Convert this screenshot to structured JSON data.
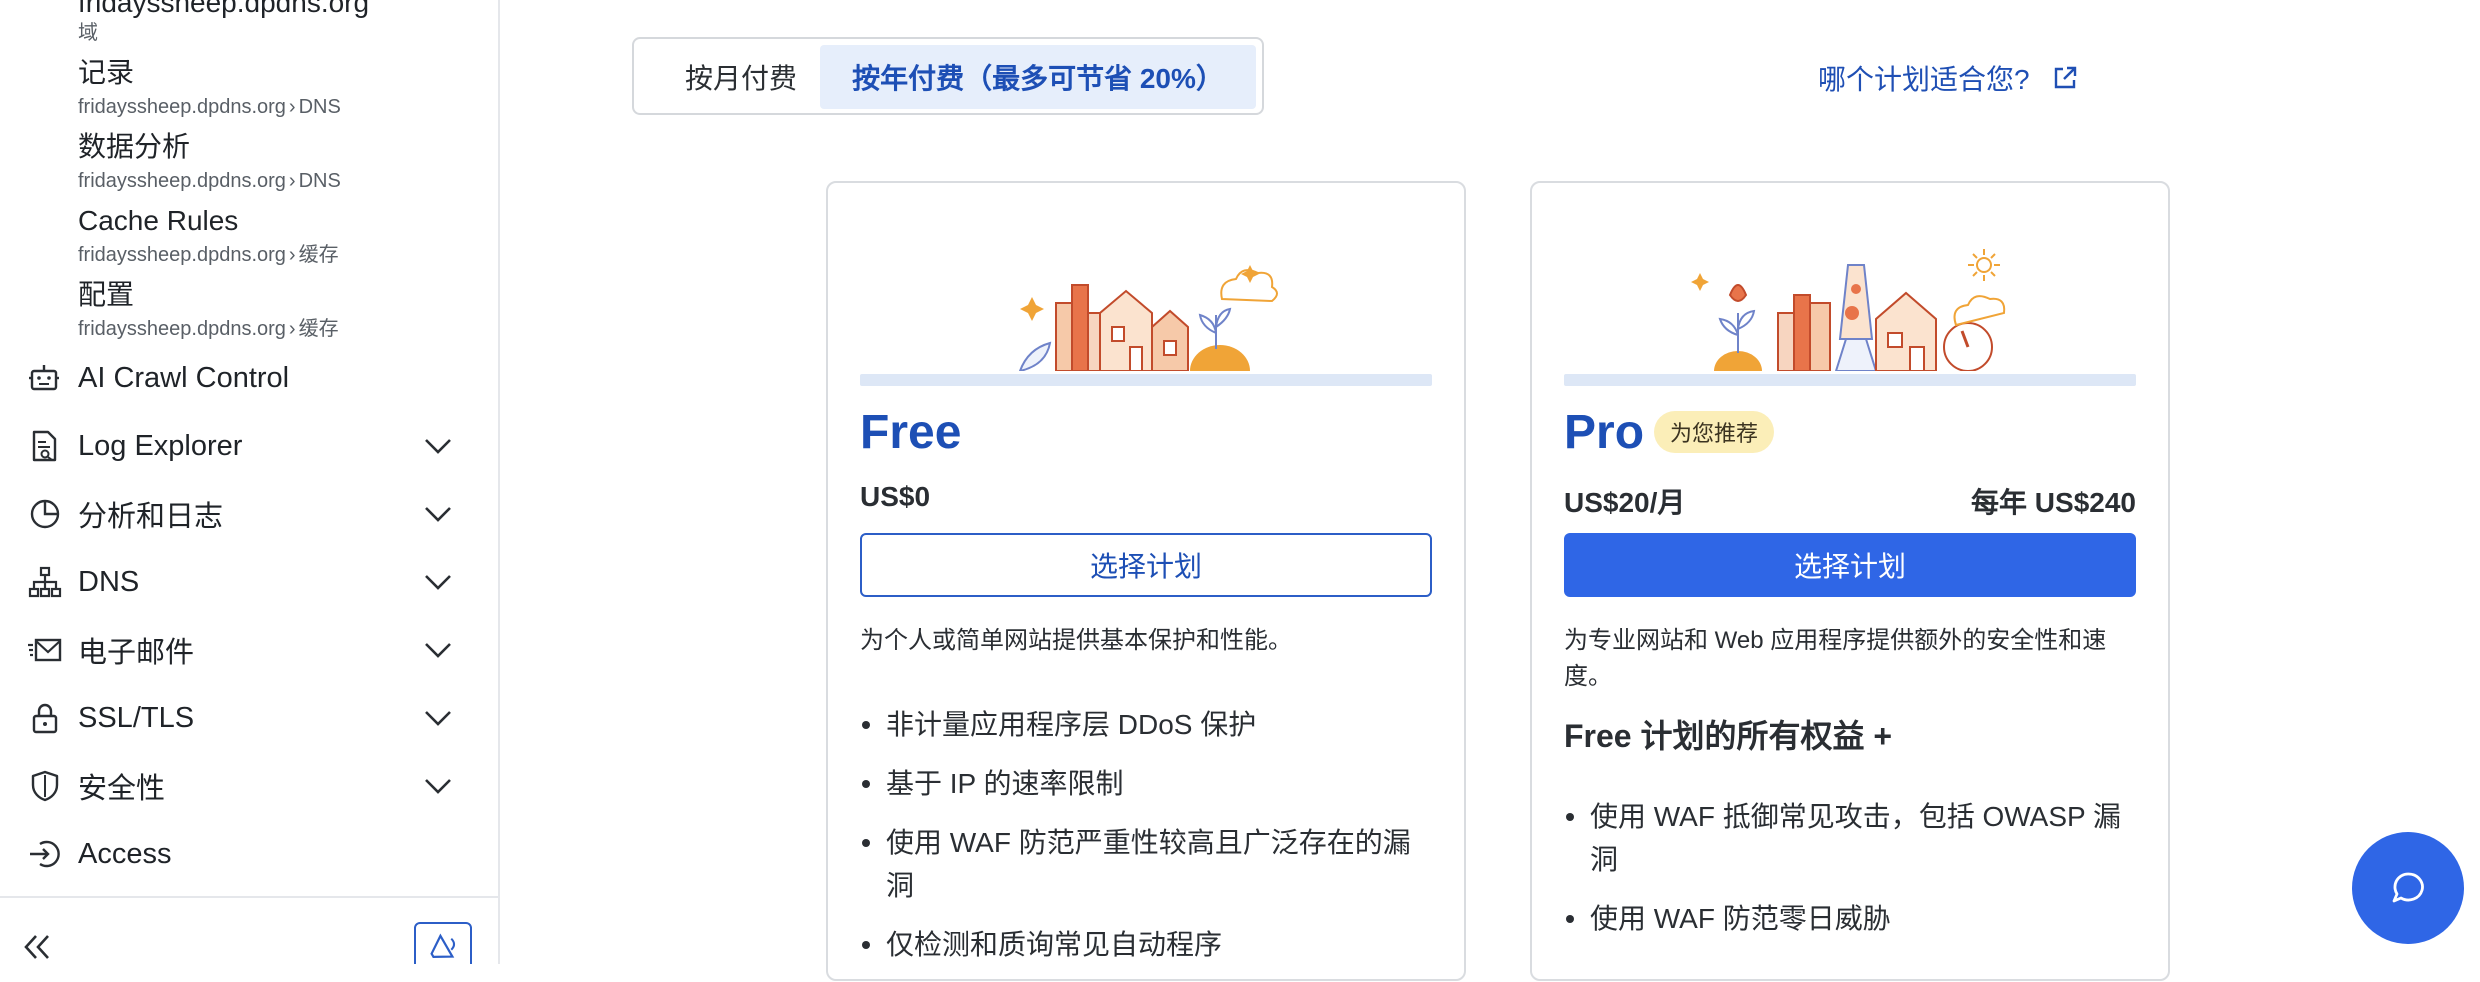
{
  "sidebar": {
    "sub_items": [
      {
        "title": "fridayssheep.dpdns.org",
        "sub": "域"
      },
      {
        "title": "记录",
        "sub_domain": "fridayssheep.dpdns.org",
        "sub_section": "DNS"
      },
      {
        "title": "数据分析",
        "sub_domain": "fridayssheep.dpdns.org",
        "sub_section": "DNS"
      },
      {
        "title": "Cache Rules",
        "sub_domain": "fridayssheep.dpdns.org",
        "sub_section": "缓存"
      },
      {
        "title": "配置",
        "sub_domain": "fridayssheep.dpdns.org",
        "sub_section": "缓存"
      }
    ],
    "nav": [
      {
        "label": "AI Crawl Control",
        "icon": "robot-icon",
        "expandable": false
      },
      {
        "label": "Log Explorer",
        "icon": "log-explorer-icon",
        "expandable": true
      },
      {
        "label": "分析和日志",
        "icon": "pie-chart-icon",
        "expandable": true
      },
      {
        "label": "DNS",
        "icon": "network-icon",
        "expandable": true
      },
      {
        "label": "电子邮件",
        "icon": "email-icon",
        "expandable": true
      },
      {
        "label": "SSL/TLS",
        "icon": "lock-icon",
        "expandable": true
      },
      {
        "label": "安全性",
        "icon": "shield-icon",
        "expandable": true
      },
      {
        "label": "Access",
        "icon": "access-icon",
        "expandable": false
      }
    ]
  },
  "billing": {
    "monthly_label": "按月付费",
    "yearly_label": "按年付费（最多可节省 20%）",
    "selected": "yearly",
    "which_plan_link": "哪个计划适合您?"
  },
  "plans": {
    "free": {
      "name": "Free",
      "price": "US$0",
      "cta": "选择计划",
      "description": "为个人或简单网站提供基本保护和性能。",
      "features": [
        "非计量应用程序层 DDoS 保护",
        "基于 IP 的速率限制",
        "使用 WAF 防范严重性较高且广泛存在的漏洞",
        "仅检测和质询常见自动程序"
      ]
    },
    "pro": {
      "name": "Pro",
      "badge": "为您推荐",
      "price": "US$20/月",
      "price_yearly": "每年 US$240",
      "cta": "选择计划",
      "description": "为专业网站和 Web 应用程序提供额外的安全性和速度。",
      "includes": "Free 计划的所有权益 +",
      "features": [
        "使用 WAF 抵御常见攻击，包括 OWASP 漏洞",
        "使用 WAF 防范零日威胁"
      ]
    }
  },
  "colors": {
    "brand_blue": "#2f66e6",
    "link_blue": "#1d4fb5",
    "badge_bg": "#fbeeb8",
    "toggle_selected_bg": "#e6eefb"
  }
}
